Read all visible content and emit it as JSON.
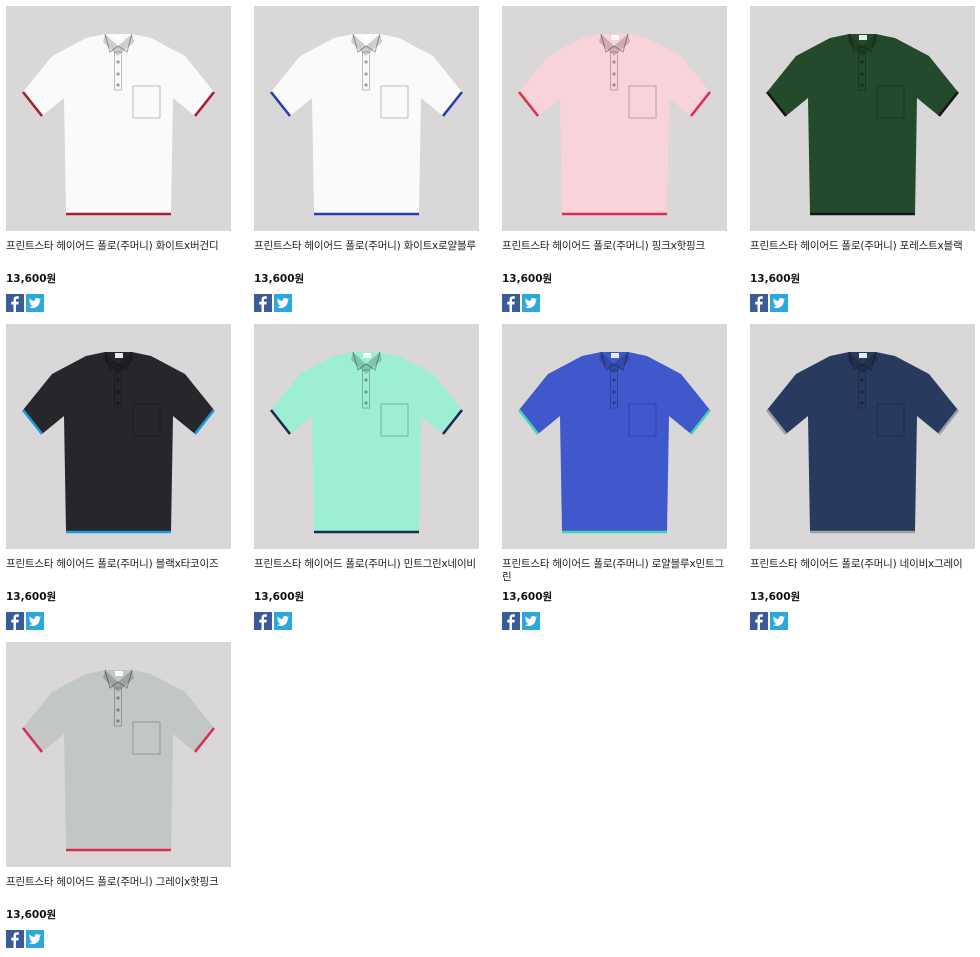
{
  "icons": {
    "facebook": "facebook-icon",
    "twitter": "twitter-icon"
  },
  "colors": {
    "background": "#ffffff",
    "thumb_bg": "#d9d7d8",
    "facebook": "#3b5a9a",
    "twitter": "#2ea7df"
  },
  "products": [
    {
      "name": "프린트스타 헤이어드 폴로(주머니) 화이트x버건디",
      "price": "13,600원",
      "body": "#fafafa",
      "trim": "#a4212f"
    },
    {
      "name": "프린트스타 헤이어드 폴로(주머니) 화이트x로얄블루",
      "price": "13,600원",
      "body": "#fafafa",
      "trim": "#2540a8"
    },
    {
      "name": "프린트스타 헤이어드 폴로(주머니) 핑크x핫핑크",
      "price": "13,600원",
      "body": "#f8d3d9",
      "trim": "#d8314f"
    },
    {
      "name": "프린트스타 헤이어드 폴로(주머니) 포레스트x블랙",
      "price": "13,600원",
      "body": "#234a2b",
      "trim": "#141614"
    },
    {
      "name": "프린트스타 헤이어드 폴로(주머니) 블랙x타코이즈",
      "price": "13,600원",
      "body": "#25272b",
      "trim": "#1f9ad6"
    },
    {
      "name": "프린트스타 헤이어드 폴로(주머니) 민트그린x네이비",
      "price": "13,600원",
      "body": "#9cefd3",
      "trim": "#1d2a4f"
    },
    {
      "name": "프린트스타 헤이어드 폴로(주머니) 로얄블루x민트그린",
      "price": "13,600원",
      "body": "#3f58cc",
      "trim": "#46d6b2"
    },
    {
      "name": "프린트스타 헤이어드 폴로(주머니) 네이비x그레이",
      "price": "13,600원",
      "body": "#283a5e",
      "trim": "#9aa0a8"
    },
    {
      "name": "프린트스타 헤이어드 폴로(주머니) 그레이x핫핑크",
      "price": "13,600원",
      "body": "#c2c6c4",
      "trim": "#dc2e55"
    }
  ]
}
